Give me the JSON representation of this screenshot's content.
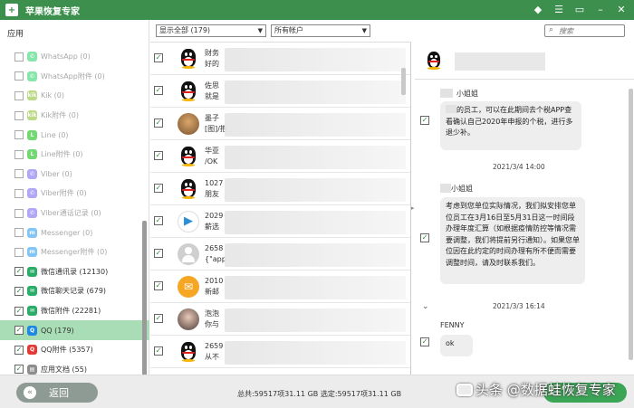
{
  "window": {
    "title": "苹果恢复专家"
  },
  "titlebar_icons": [
    "diamond-icon",
    "hamburger-menu-icon",
    "message-icon",
    "minimize-icon",
    "close-icon"
  ],
  "sidebar": {
    "heading": "应用",
    "items": [
      {
        "label": "WhatsApp (0)",
        "icon": "whatsapp-icon",
        "checked": false,
        "enabled": false,
        "color": "#25d366"
      },
      {
        "label": "WhatsApp附件 (0)",
        "icon": "whatsapp-icon",
        "checked": false,
        "enabled": false,
        "color": "#25d366"
      },
      {
        "label": "Kik (0)",
        "icon": "kik-icon",
        "checked": false,
        "enabled": false,
        "color": "#82bc23"
      },
      {
        "label": "Kik附件 (0)",
        "icon": "kik-icon",
        "checked": false,
        "enabled": false,
        "color": "#82bc23"
      },
      {
        "label": "Line (0)",
        "icon": "line-icon",
        "checked": false,
        "enabled": false,
        "color": "#00b900"
      },
      {
        "label": "Line附件 (0)",
        "icon": "line-icon",
        "checked": false,
        "enabled": false,
        "color": "#00b900"
      },
      {
        "label": "Viber (0)",
        "icon": "viber-icon",
        "checked": false,
        "enabled": false,
        "color": "#7360f2"
      },
      {
        "label": "Viber附件 (0)",
        "icon": "viber-icon",
        "checked": false,
        "enabled": false,
        "color": "#7360f2"
      },
      {
        "label": "Viber通话记录 (0)",
        "icon": "viber-icon",
        "checked": false,
        "enabled": false,
        "color": "#7360f2"
      },
      {
        "label": "Messenger (0)",
        "icon": "messenger-icon",
        "checked": false,
        "enabled": false,
        "color": "#2196f3"
      },
      {
        "label": "Messenger附件 (0)",
        "icon": "messenger-icon",
        "checked": false,
        "enabled": false,
        "color": "#2196f3"
      },
      {
        "label": "微信通讯录 (12130)",
        "icon": "wechat-icon",
        "checked": true,
        "enabled": true,
        "color": "#2aae67"
      },
      {
        "label": "微信聊天记录 (679)",
        "icon": "wechat-icon",
        "checked": true,
        "enabled": true,
        "color": "#2aae67"
      },
      {
        "label": "微信附件 (22281)",
        "icon": "wechat-icon",
        "checked": true,
        "enabled": true,
        "color": "#2aae67"
      },
      {
        "label": "QQ (179)",
        "icon": "qq-icon",
        "checked": true,
        "enabled": true,
        "color": "#1e88e5",
        "active": true
      },
      {
        "label": "QQ附件 (5357)",
        "icon": "qq-icon",
        "checked": true,
        "enabled": true,
        "color": "#e53935"
      },
      {
        "label": "应用文档 (55)",
        "icon": "document-icon",
        "checked": true,
        "enabled": true,
        "color": "#8d8d8d"
      }
    ]
  },
  "toolbar": {
    "filter_select": "显示全部 (179)",
    "account_select": "所有帐户",
    "search_placeholder": "搜索"
  },
  "messages": [
    {
      "line1": "财务",
      "line2": "好的",
      "avatar": "qq"
    },
    {
      "line1": "佐思",
      "line2": "就是",
      "avatar": "qq"
    },
    {
      "line1": "墨子",
      "line2": "[图]/抱",
      "avatar": "photo1"
    },
    {
      "line1": "华亚",
      "line2": "/OK",
      "avatar": "qq"
    },
    {
      "line1": "1027",
      "line2": "朋友",
      "avatar": "qq"
    },
    {
      "line1": "2029",
      "line2": "薪选",
      "avatar": "play"
    },
    {
      "line1": "2658",
      "line2": "{\"app",
      "avatar": "gray"
    },
    {
      "line1": "2010",
      "line2": "新邮",
      "avatar": "mail"
    },
    {
      "line1": "泡泡",
      "line2": "你与",
      "avatar": "photo2"
    },
    {
      "line1": "2659",
      "line2": "从不",
      "avatar": "qq"
    }
  ],
  "chat": {
    "sender1": "小姐姐",
    "bubble1": "的员工，可以在此期间去个税APP查看确认自己2020年申报的个税，进行多退少补。",
    "time1": "2021/3/4 14:00",
    "sender2": "小姐姐",
    "bubble2": "考虑到您单位实际情况，我们拟安排您单位员工在3月16日至5月31日这一时间段办理年度汇算（如根据疫情防控等情况需要调整，我们将提前另行通知）。如果您单位因在此约定的时间办理有所不便而需要调整时间，请及时联系我们。",
    "time2": "2021/3/3 16:14",
    "sender3": "FENNY",
    "bubble3": "ok"
  },
  "bottom": {
    "back_label": "返回",
    "status": "总共:59517项31.11 GB 选定:59517项31.11 GB",
    "watermark": "头条 @数据蛙恢复专家"
  }
}
